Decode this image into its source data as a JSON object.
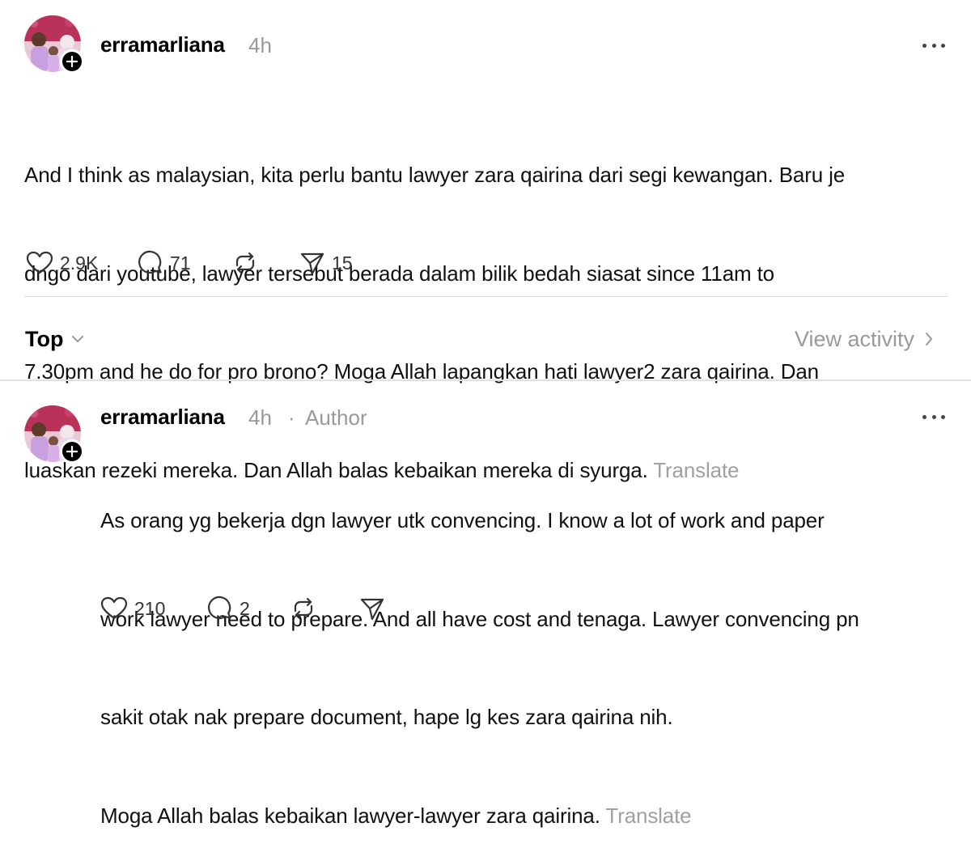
{
  "post": {
    "username": "erramarliana",
    "time": "4h",
    "more_icon": "more-dots-icon",
    "lines": [
      "And I think as malaysian, kita perlu bantu lawyer zara qairina dari segi kewangan. Baru je",
      "dngo dari youtube, lawyer tersebut berada dalam bilik bedah siasat since 11am to",
      "7.30pm and he do for pro brono? Moga Allah lapangkan hati lawyer2 zara qairina. Dan",
      "luaskan rezeki mereka. Dan Allah balas kebaikan mereka di syurga. "
    ],
    "translate_label": "Translate",
    "actions": {
      "likes": "2.9K",
      "replies": "71",
      "shares": "15"
    }
  },
  "filter_bar": {
    "sort_label": "Top",
    "view_activity_label": "View activity"
  },
  "reply": {
    "username": "erramarliana",
    "time": "4h",
    "separator": "·",
    "author_badge": "Author",
    "lines": [
      "As orang yg bekerja dgn lawyer utk convencing. I know a lot of work and paper",
      "work lawyer need to prepare. And all have cost and tenaga. Lawyer convencing pn",
      "sakit otak nak prepare document, hape lg kes zara qairina nih.",
      "Moga Allah balas kebaikan lawyer-lawyer zara qairina. "
    ],
    "translate_label": "Translate",
    "actions": {
      "likes": "210",
      "replies": "2"
    }
  },
  "colors": {
    "text": "#111111",
    "muted": "#999999",
    "divider": "#dddddd"
  },
  "icons": [
    "avatar-photo",
    "plus-icon",
    "more-dots-icon",
    "heart-icon",
    "comment-icon",
    "repost-icon",
    "send-icon",
    "chevron-down-icon",
    "chevron-right-icon"
  ]
}
